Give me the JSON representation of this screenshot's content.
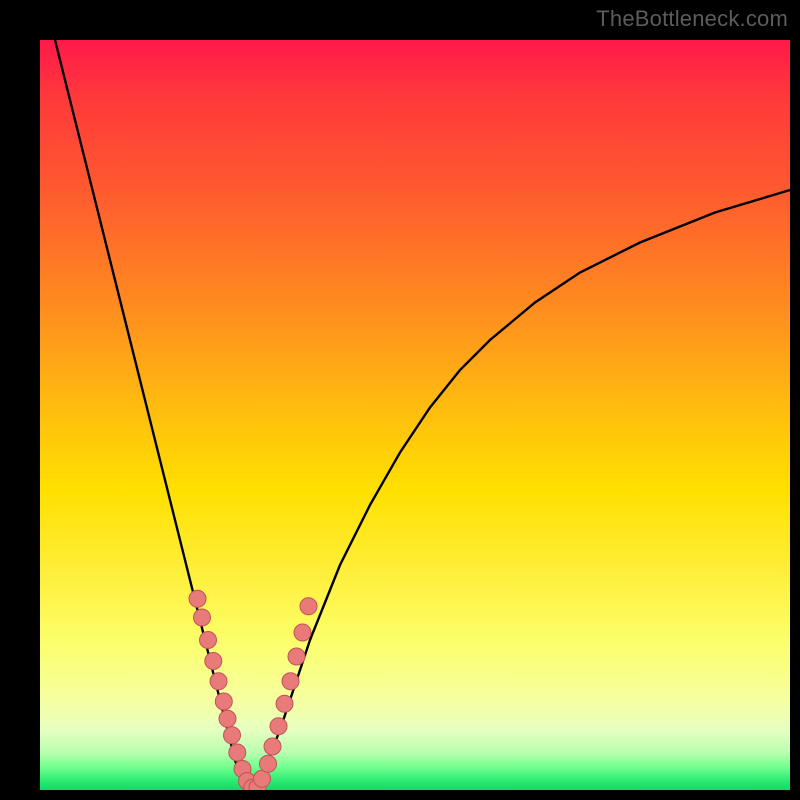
{
  "watermark": "TheBottleneck.com",
  "colors": {
    "frame": "#000000",
    "curve": "#000000",
    "dot_fill": "#e87a7a",
    "dot_stroke": "#c05454"
  },
  "chart_data": {
    "type": "line",
    "title": "",
    "xlabel": "",
    "ylabel": "",
    "xlim": [
      0,
      100
    ],
    "ylim": [
      0,
      100
    ],
    "note": "V-shaped bottleneck curve. y is the bottleneck percentage; the minimum (y≈0) occurs near x≈28. x-axis shown left→right, y-axis shown top(100)→bottom(0). Values are estimated from the rendered pixels (no tick labels present).",
    "series": [
      {
        "name": "curve-left",
        "x": [
          2,
          4,
          6,
          8,
          10,
          12,
          14,
          16,
          18,
          20,
          22,
          24,
          25,
          26,
          27,
          28
        ],
        "y": [
          100,
          92,
          84,
          76,
          68,
          60,
          52,
          44,
          36,
          28,
          20,
          12,
          8,
          4,
          1,
          0
        ]
      },
      {
        "name": "curve-right",
        "x": [
          28,
          30,
          32,
          34,
          36,
          38,
          40,
          44,
          48,
          52,
          56,
          60,
          66,
          72,
          80,
          90,
          100
        ],
        "y": [
          0,
          3,
          8,
          14,
          20,
          25,
          30,
          38,
          45,
          51,
          56,
          60,
          65,
          69,
          73,
          77,
          80
        ]
      }
    ],
    "dots": {
      "name": "highlight-points",
      "note": "Salmon dots clustered around the valley of the V.",
      "x": [
        21.0,
        21.6,
        22.4,
        23.1,
        23.8,
        24.5,
        25.0,
        25.6,
        26.3,
        27.0,
        27.6,
        28.3,
        29.0,
        29.6,
        30.4,
        31.0,
        31.8,
        32.6,
        33.4,
        34.2,
        35.0,
        35.8
      ],
      "y": [
        25.5,
        23.0,
        20.0,
        17.2,
        14.5,
        11.8,
        9.5,
        7.3,
        5.0,
        2.8,
        1.2,
        0.3,
        0.3,
        1.5,
        3.5,
        5.8,
        8.5,
        11.5,
        14.5,
        17.8,
        21.0,
        24.5
      ]
    }
  }
}
